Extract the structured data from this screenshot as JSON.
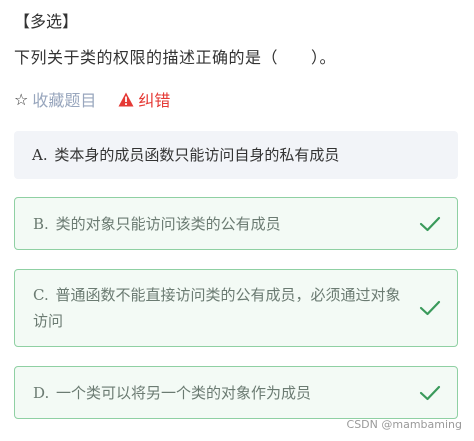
{
  "question": {
    "type_tag": "【多选】",
    "text": "下列关于类的权限的描述正确的是（　　）。"
  },
  "actions": {
    "favorite_icon": "star-outline-icon",
    "favorite_label": "收藏题目",
    "report_icon": "warning-triangle-icon",
    "report_label": "纠错",
    "colors": {
      "favorite": "#98a6bd",
      "report": "#e53935"
    }
  },
  "options": [
    {
      "letter": "A.",
      "text": "类本身的成员函数只能访问自身的私有成员",
      "correct": false
    },
    {
      "letter": "B.",
      "text": "类的对象只能访问该类的公有成员",
      "correct": true
    },
    {
      "letter": "C.",
      "text": "普通函数不能直接访问类的公有成员，必须通过对象访问",
      "correct": true
    },
    {
      "letter": "D.",
      "text": "一个类可以将另一个类的对象作为成员",
      "correct": true
    }
  ],
  "colors": {
    "correct_border": "#8fd0a3",
    "correct_bg": "#f3faf5",
    "check": "#3a9a5b",
    "neutral_bg": "#f2f4f8"
  },
  "watermark": "CSDN @mambaming"
}
